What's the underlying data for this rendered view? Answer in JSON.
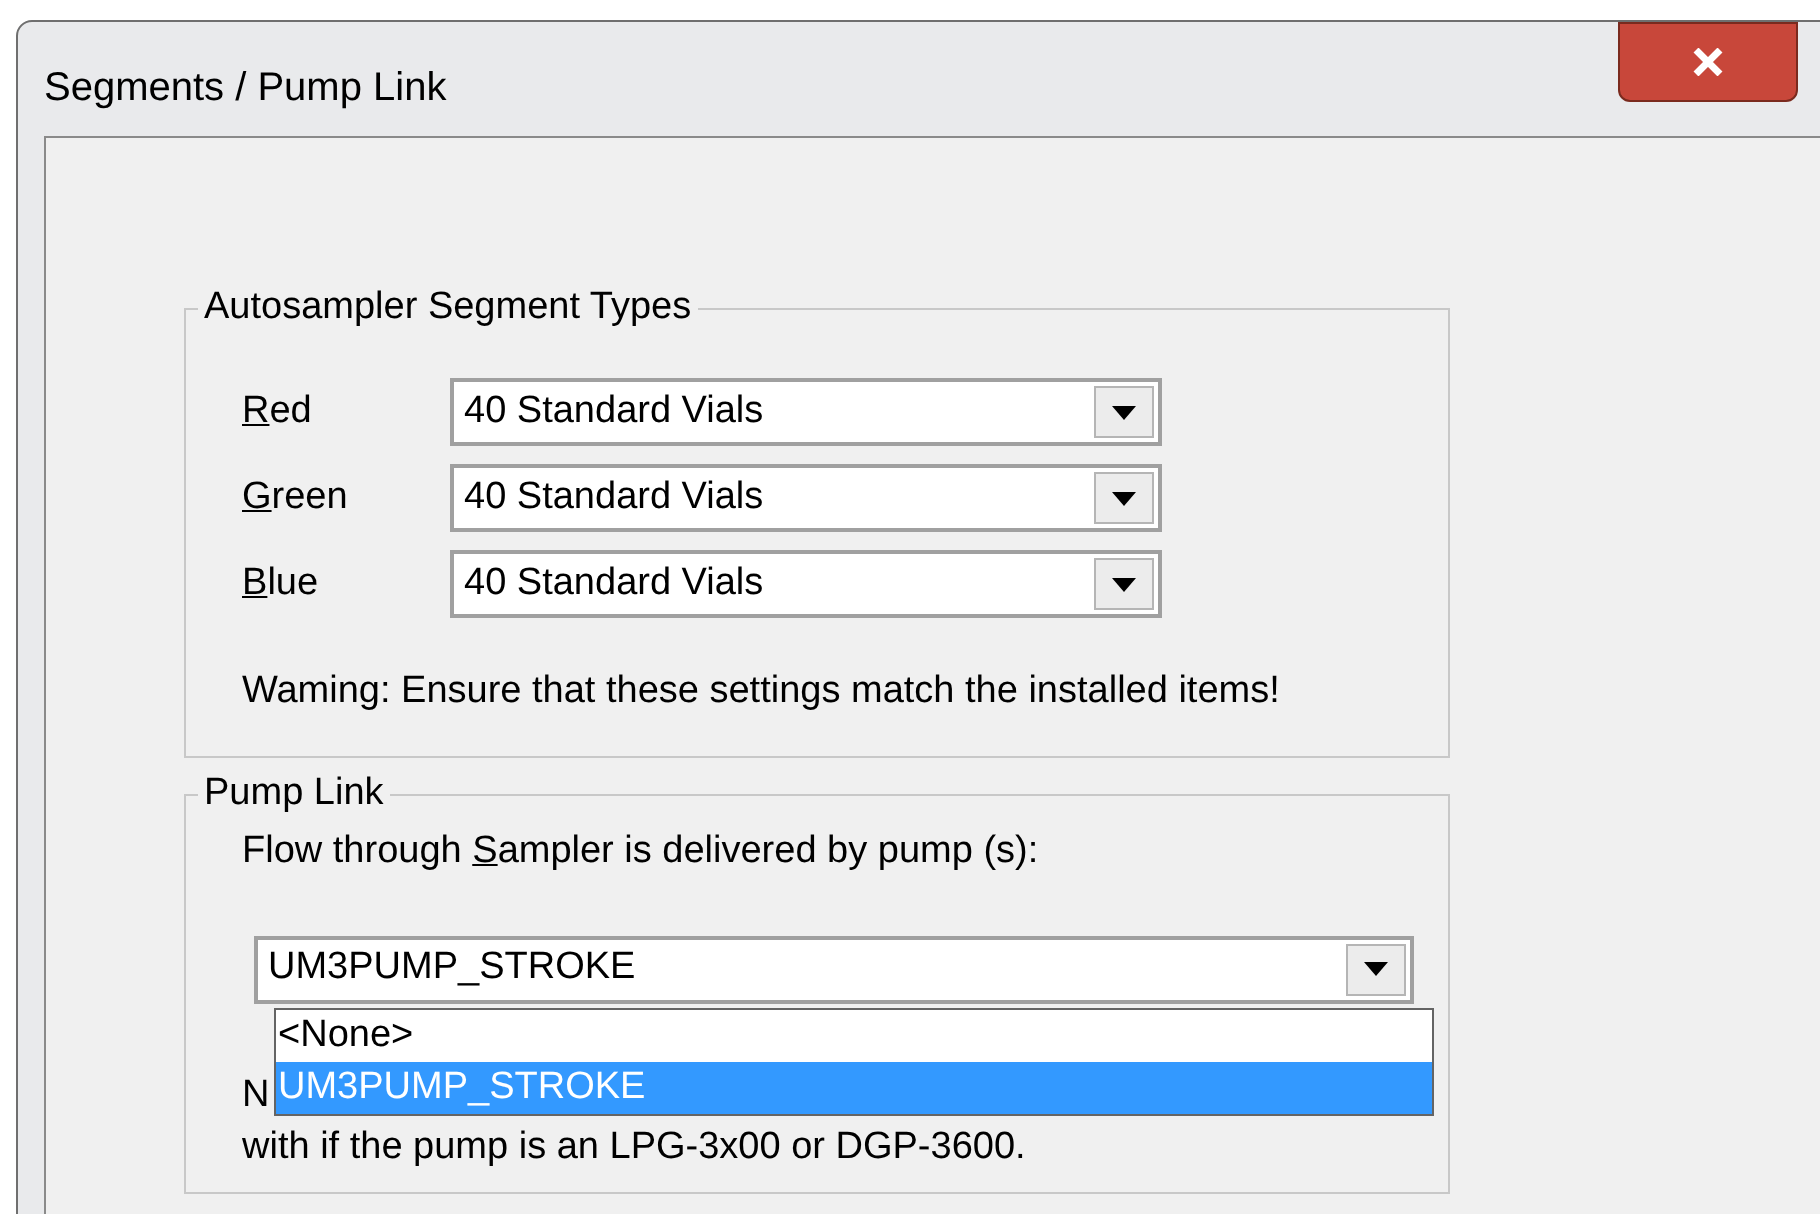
{
  "window": {
    "title": "Segments / Pump Link"
  },
  "segment_group": {
    "legend": "Autosampler Segment Types",
    "rows": [
      {
        "access_key": "R",
        "label_rest": "ed",
        "value": "40 Standard Vials"
      },
      {
        "access_key": "G",
        "label_rest": "reen",
        "value": "40 Standard Vials"
      },
      {
        "access_key": "B",
        "label_rest": "lue",
        "value": "40 Standard Vials"
      }
    ],
    "warning": "Waming: Ensure that these settings match the installed items!"
  },
  "pump_group": {
    "legend": "Pump Link",
    "prompt_before": "Flow through ",
    "prompt_key": "S",
    "prompt_after": "ampler is delivered by pump (s):",
    "value": "UM3PUMP_STROKE",
    "expanded": true,
    "options": [
      {
        "label": "<None>",
        "selected": false
      },
      {
        "label": "UM3PUMP_STROKE",
        "selected": true
      }
    ],
    "note_start": "N",
    "note_end": "with if the pump is an LPG-3x00 or DGP-3600."
  }
}
